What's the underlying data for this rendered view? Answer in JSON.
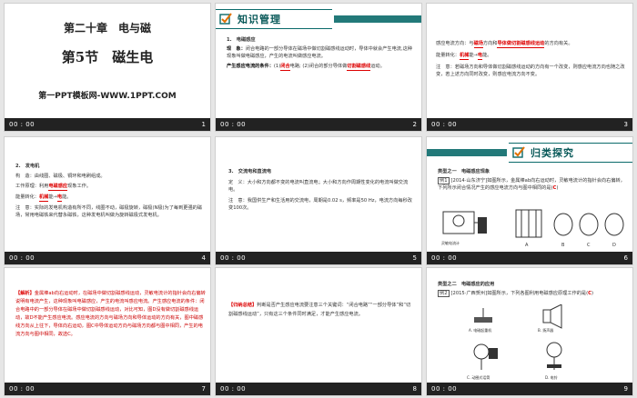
{
  "footer": {
    "time": "00 : 00"
  },
  "slides": [
    {
      "number": "1",
      "chapter": "第二十章　电与磁",
      "section": "第5节　磁生电",
      "site": "第一PPT模板网-WWW.1PPT.COM"
    },
    {
      "number": "2",
      "banner": "知识管理",
      "h1": "1.　电磁感应",
      "p1_label": "现　象：",
      "p1": "闭合电路的一部分导体在磁场中做切割磁感线运动时，导体中就会产生电流,这种现象叫做电磁感应，产生的电流叫做感应电流。",
      "p2_label": "产生感应电流的条件：",
      "p2_a": "(1)",
      "p2_b": "闭合",
      "p2_c": "电路; (2)闭合的部分导体做",
      "p2_d": "切割磁感线",
      "p2_e": "运动。"
    },
    {
      "number": "3",
      "line1_a": "感应电流方向：与",
      "line1_b": "磁场",
      "line1_c": "方向和",
      "line1_d": "导体做切割磁感线运动",
      "line1_e": "的方向有关。",
      "line2_a": "能量转化：",
      "line2_b": "机械",
      "line2_c": "能→",
      "line2_d": "电",
      "line2_e": "能。",
      "line3": "注　意：若磁场方向和导体做切割磁感线运动的方向有一个改变，则感应电流方向也随之改变，若上述方向同时改变，则感应电流方向不变。"
    },
    {
      "number": "4",
      "h1": "2.　发电机",
      "l1": "构　造：由线圈、磁极、铜环和电刷组成。",
      "l2_a": "工作原理：利用",
      "l2_b": "电磁感应",
      "l2_c": "现象工作。",
      "l3_a": "能量转化：",
      "l3_b": "机械",
      "l3_c": "能→",
      "l3_d": "电",
      "l3_e": "能。",
      "l4": "注　意：实际的发电机构造有所不同，线圈不动，磁极旋转，磁极(N极)为了每到更强的磁场，常用电磁铁来代替永磁铁，这种发电机叫做为旋转磁极式发电机。"
    },
    {
      "number": "5",
      "h1": "3.　交流电和直流电",
      "l1": "定　义：大小和方向都不变的电流叫直流电；大小和方向作周期性变化的电流叫做交流电。",
      "l2": "注　意：我国供生产和生活用的交流电，周期是0.02 s，频率是50 Hz，电流方向每秒改变100次。"
    },
    {
      "number": "6",
      "banner": "归类探究",
      "type_label": "类型之一　电磁感应现象",
      "q1": "例1",
      "q_text": "[2014·山东济宁]如图所示，金属棒ab向右运动时，灵敏电流计的指针会向右偏转，下列所示闭合情况产生的感应电流方向与图中相同的是(",
      "answer": "C",
      "q_end": ")",
      "options": [
        "A",
        "B",
        "C",
        "D"
      ],
      "fig_label": "灵敏电流计"
    },
    {
      "number": "7",
      "label": "【解析】",
      "text": "金属棒ab向右运动时，在磁场中做切割磁感线运动，灵敏电流计的指针会向右偏转说明有电流产生，这种现象叫电磁感应，产生的电流叫感应电流。产生感应电流的条件：闭合电路中的一部分导体在磁场中做切割磁感线运动，对比可知，图D没有做切割磁感线运动，故D不能产生感应电流。感应电流的方向与磁场方向和导体运动的方向有关，图中磁感线方向从上往下，导体向右运动，图C中导体运动方向与磁场方向都与图中相同，产生的电流方向与图中相同，故选C。"
    },
    {
      "number": "8",
      "label": "【归纳总结】",
      "text": "判断是否产生感应电流要注意三个关键词：“闭合电路”“一部分导体”和“切割磁感线运动”，只有这三个条件同时满足，才能产生感应电流。"
    },
    {
      "number": "9",
      "type_label": "类型之二　电磁感应的应用",
      "q1": "例2",
      "q_text": "[2015·广西贺州]如图所示，下列各图利用电磁感应原理工作的是(",
      "answer": "C",
      "q_end": ")",
      "captions": [
        "A. 电磁起重机",
        "B. 扬声器",
        "C. 动圈式话筒",
        "D. 电铃"
      ]
    }
  ]
}
